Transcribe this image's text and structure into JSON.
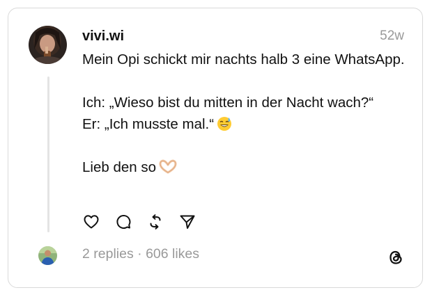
{
  "post": {
    "username": "vivi.wi",
    "timestamp": "52w",
    "lines": {
      "line1": "Mein Opi schickt mir nachts halb 3 eine WhatsApp.",
      "line2": "Ich: „Wieso bist du mitten in der Nacht wach?“",
      "line3": "Er: „Ich musste mal.“",
      "line4": "Lieb den so"
    },
    "emojis": {
      "line3": "sweat-smile-emoji",
      "line4": "heart-hands-emoji"
    }
  },
  "stats": {
    "replies": "2 replies",
    "separator": " · ",
    "likes": "606 likes"
  },
  "icons": {
    "like": "heart-icon",
    "reply": "speech-bubble-icon",
    "repost": "repost-icon",
    "share": "send-icon",
    "brand": "threads-logo-icon"
  },
  "colors": {
    "text": "#111111",
    "muted": "#999999",
    "border": "#d9d9d9",
    "thread_line": "#e4e4e4"
  }
}
